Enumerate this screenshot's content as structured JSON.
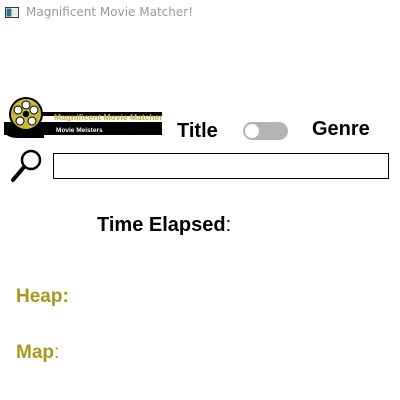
{
  "window": {
    "title": "Magnificent Movie Matcher!"
  },
  "logo": {
    "line1": "Magnificent Movie Matcher",
    "line2": "Movie Meisters"
  },
  "search_mode": {
    "left_label": "Title",
    "right_label": "Genre",
    "toggle_on": false
  },
  "search": {
    "value": "",
    "placeholder": ""
  },
  "stats": {
    "time_elapsed_label": "Time Elapsed",
    "heap_label": "Heap",
    "map_label": "Map",
    "separator": ":"
  },
  "colors": {
    "accent_olive": "#a8981c",
    "toggle_track": "#b4b4b4"
  }
}
